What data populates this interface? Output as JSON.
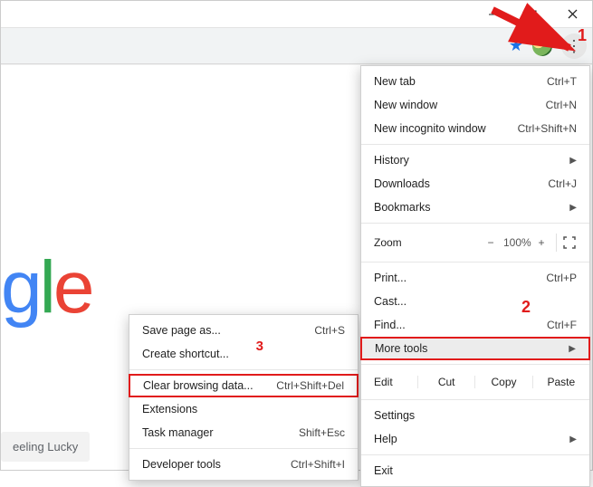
{
  "window": {
    "minimize": "–",
    "maximize": "▢",
    "close": "×"
  },
  "toolbar": {
    "star_icon": "bookmark-star",
    "avatar": "profile-avatar",
    "menu_icon": "vertical-dots"
  },
  "logo_fragment": "gle",
  "lucky_button": "eeling Lucky",
  "menu": {
    "new_tab": {
      "label": "New tab",
      "shortcut": "Ctrl+T"
    },
    "new_window": {
      "label": "New window",
      "shortcut": "Ctrl+N"
    },
    "new_incognito": {
      "label": "New incognito window",
      "shortcut": "Ctrl+Shift+N"
    },
    "history": {
      "label": "History"
    },
    "downloads": {
      "label": "Downloads",
      "shortcut": "Ctrl+J"
    },
    "bookmarks": {
      "label": "Bookmarks"
    },
    "zoom": {
      "label": "Zoom",
      "value": "100%"
    },
    "print": {
      "label": "Print...",
      "shortcut": "Ctrl+P"
    },
    "cast": {
      "label": "Cast..."
    },
    "find": {
      "label": "Find...",
      "shortcut": "Ctrl+F"
    },
    "more_tools": {
      "label": "More tools"
    },
    "edit": {
      "label": "Edit",
      "cut": "Cut",
      "copy": "Copy",
      "paste": "Paste"
    },
    "settings": {
      "label": "Settings"
    },
    "help": {
      "label": "Help"
    },
    "exit": {
      "label": "Exit"
    }
  },
  "submenu": {
    "save_page": {
      "label": "Save page as...",
      "shortcut": "Ctrl+S"
    },
    "create_shortcut": {
      "label": "Create shortcut..."
    },
    "clear_data": {
      "label": "Clear browsing data...",
      "shortcut": "Ctrl+Shift+Del"
    },
    "extensions": {
      "label": "Extensions"
    },
    "task_manager": {
      "label": "Task manager",
      "shortcut": "Shift+Esc"
    },
    "dev_tools": {
      "label": "Developer tools",
      "shortcut": "Ctrl+Shift+I"
    }
  },
  "annotations": {
    "a1": "1",
    "a2": "2",
    "a3": "3"
  }
}
